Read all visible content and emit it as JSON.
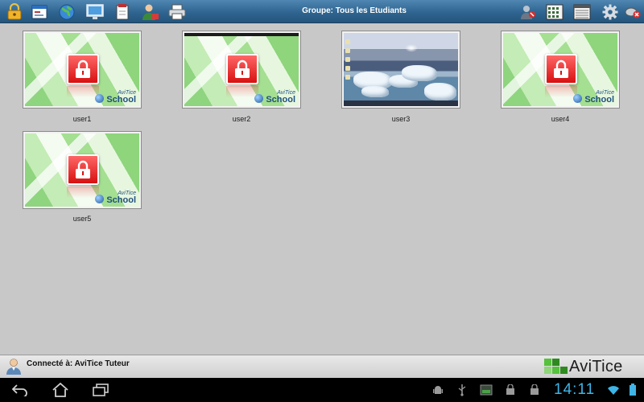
{
  "toolbar": {
    "title": "Groupe: Tous les Etudiants",
    "left_icons": [
      "lock-icon",
      "window-icon",
      "globe-icon",
      "monitor-icon",
      "document-icon",
      "user-send-icon",
      "printer-icon"
    ],
    "right_icons": [
      "user-group-icon",
      "grid-view-icon",
      "list-view-icon",
      "gear-icon",
      "disconnect-icon"
    ]
  },
  "students": [
    {
      "label": "user1",
      "state": "locked"
    },
    {
      "label": "user2",
      "state": "locked"
    },
    {
      "label": "user3",
      "state": "desktop"
    },
    {
      "label": "user4",
      "state": "locked"
    },
    {
      "label": "user5",
      "state": "locked"
    }
  ],
  "lockscreen": {
    "brand_top": "AviTice",
    "brand_bottom": "School"
  },
  "status": {
    "connected_text": "Connecté à: AviTice Tuteur",
    "logo_text": "AviTice",
    "logo_color": "#56c13c"
  },
  "system_bar": {
    "time": "14:11",
    "nav": [
      "back-icon",
      "home-icon",
      "recent-apps-icon"
    ],
    "tray": [
      "android-debug-icon",
      "usb-icon",
      "screenshot-icon",
      "shopping-bag-icon",
      "shopping-bag-icon",
      "wifi-icon",
      "battery-icon"
    ],
    "accent": "#3fb4e6"
  }
}
